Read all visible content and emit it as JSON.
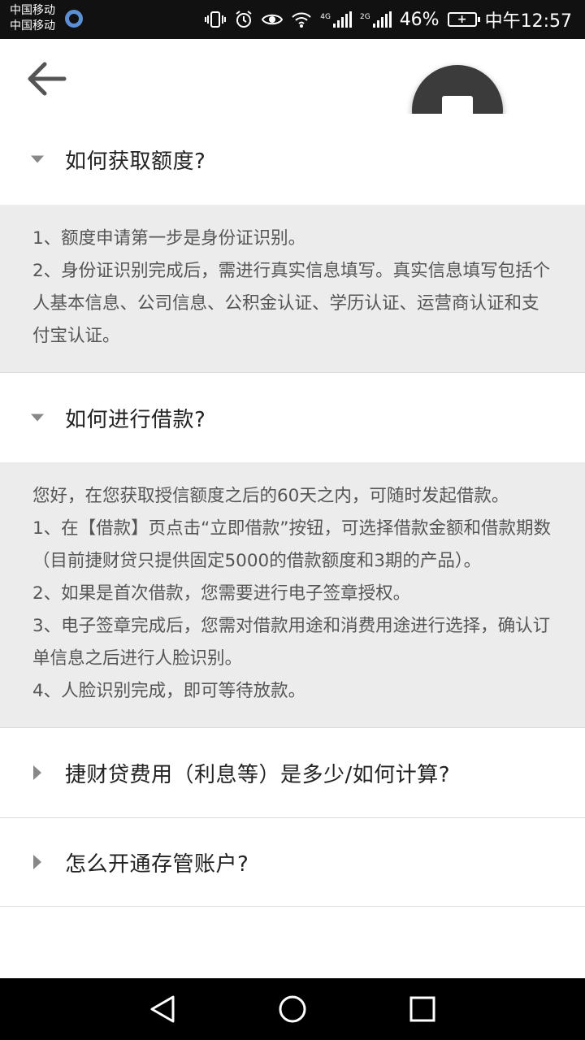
{
  "status_bar": {
    "carrier_line1": "中国移动",
    "carrier_line2": "中国移动",
    "network1": "4G",
    "network2": "2G",
    "battery_percent": "46%",
    "time": "中午12:57",
    "icons": [
      "vibrate-icon",
      "alarm-icon",
      "eye-icon",
      "wifi-icon",
      "signal-icon",
      "signal-icon",
      "battery-icon"
    ]
  },
  "header": {
    "back_icon": "arrow-left-icon",
    "chat_icon": "chat-bubble-icon"
  },
  "faq": [
    {
      "title": "如何获取额度?",
      "expanded": true,
      "body": [
        "1、额度申请第一步是身份证识别。",
        "2、身份证识别完成后，需进行真实信息填写。真实信息填写包括个人基本信息、公司信息、公积金认证、学历认证、运营商认证和支付宝认证。"
      ]
    },
    {
      "title": "如何进行借款?",
      "expanded": true,
      "body": [
        "您好，在您获取授信额度之后的60天之内，可随时发起借款。",
        "1、在【借款】页点击“立即借款”按钮，可选择借款金额和借款期数（目前捷财贷只提供固定5000的借款额度和3期的产品）。",
        "2、如果是首次借款，您需要进行电子签章授权。",
        "3、电子签章完成后，您需对借款用途和消费用途进行选择，确认订单信息之后进行人脸识别。",
        "4、人脸识别完成，即可等待放款。"
      ]
    },
    {
      "title": "捷财贷费用（利息等）是多少/如何计算?",
      "expanded": false,
      "body": []
    },
    {
      "title": "怎么开通存管账户?",
      "expanded": false,
      "body": []
    }
  ],
  "nav_bar": {
    "buttons": [
      "back-triangle-icon",
      "home-circle-icon",
      "recents-square-icon"
    ]
  }
}
